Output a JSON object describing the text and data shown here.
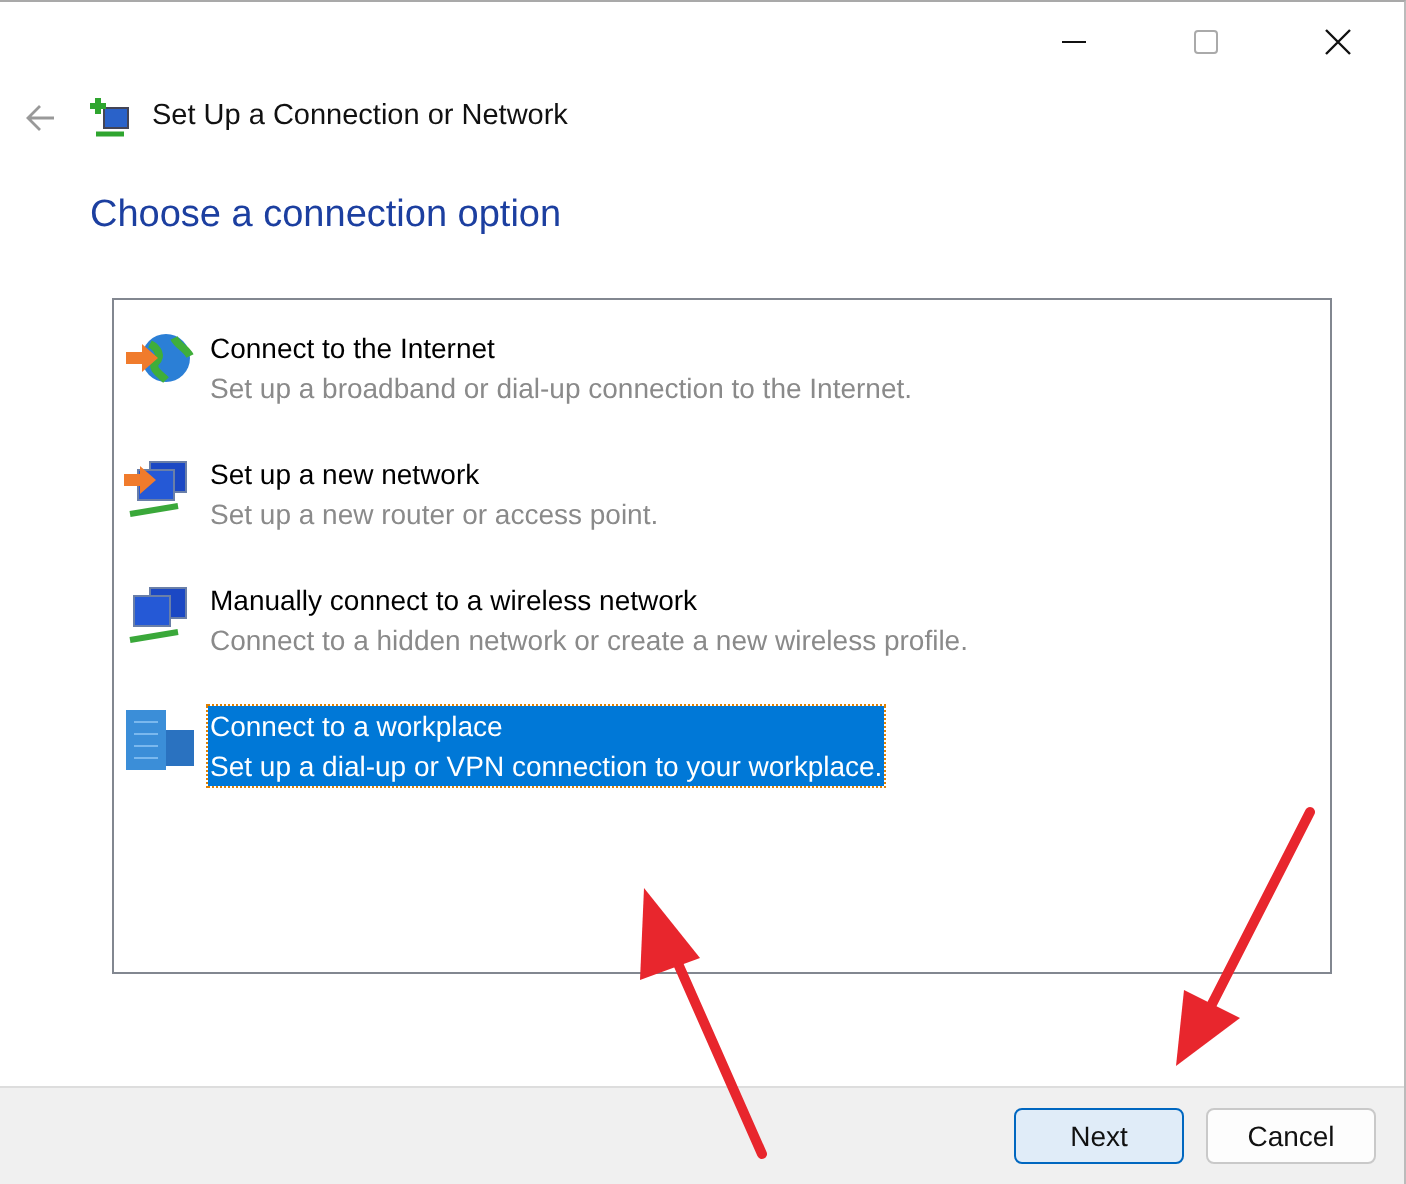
{
  "window": {
    "title": "Set Up a Connection or Network"
  },
  "heading": "Choose a connection option",
  "options": [
    {
      "kind": "internet",
      "title": "Connect to the Internet",
      "description": "Set up a broadband or dial-up connection to the Internet.",
      "selected": false
    },
    {
      "kind": "network",
      "title": "Set up a new network",
      "description": "Set up a new router or access point.",
      "selected": false
    },
    {
      "kind": "wireless",
      "title": "Manually connect to a wireless network",
      "description": "Connect to a hidden network or create a new wireless profile.",
      "selected": false
    },
    {
      "kind": "workplace",
      "title": "Connect to a workplace",
      "description": "Set up a dial-up or VPN connection to your workplace.",
      "selected": true
    }
  ],
  "buttons": [
    {
      "label": "Next",
      "default": true
    },
    {
      "label": "Cancel",
      "default": false
    }
  ]
}
